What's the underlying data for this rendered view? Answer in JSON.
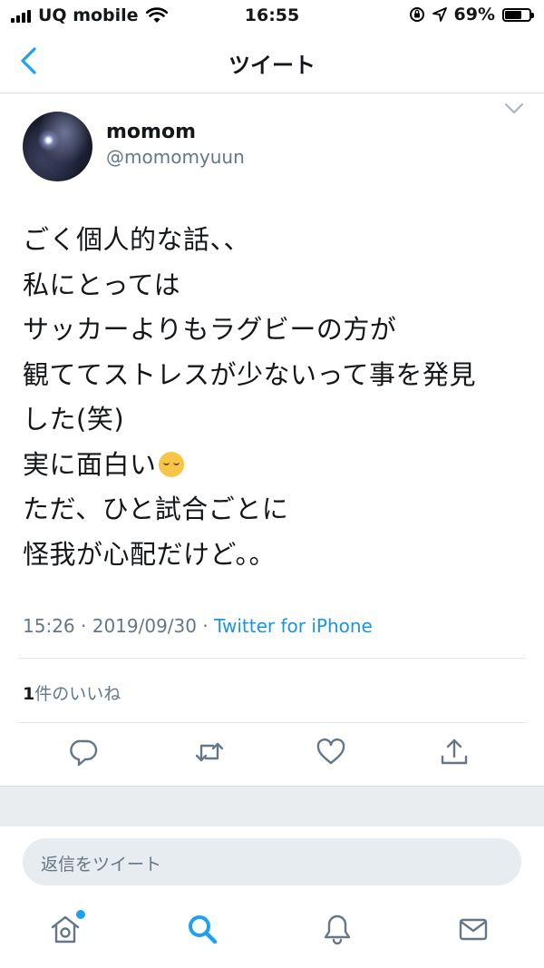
{
  "status_bar": {
    "carrier": "UQ mobile",
    "time": "16:55",
    "battery_percent_text": "69%",
    "battery_level": 0.69
  },
  "header": {
    "title": "ツイート"
  },
  "tweet": {
    "author_name": "momom",
    "author_handle": "@momomyuun",
    "text_lines": [
      "ごく個人的な話、、",
      "私にとっては",
      "サッカーよりもラグビーの方が",
      "観ててストレスが少ないって事を発見",
      "した(笑)",
      "実に面白い",
      "ただ、ひと試合ごとに",
      "怪我が心配だけど。。"
    ],
    "emoji_after_line_6": "smiling-face-icon",
    "time": "15:26",
    "date": "2019/09/30",
    "separator": "·",
    "source": "Twitter for iPhone"
  },
  "likes": {
    "count": "1",
    "label": "件のいいね"
  },
  "actions": {
    "icons": [
      "reply-icon",
      "retweet-icon",
      "like-icon",
      "share-icon"
    ]
  },
  "reply_box": {
    "placeholder": "返信をツイート"
  },
  "tab_bar": {
    "icons": [
      "home-icon",
      "search-icon",
      "notifications-icon",
      "messages-icon"
    ]
  },
  "colors": {
    "accent": "#1da1f2",
    "secondary_text": "#657786",
    "link": "#1b95e0"
  }
}
